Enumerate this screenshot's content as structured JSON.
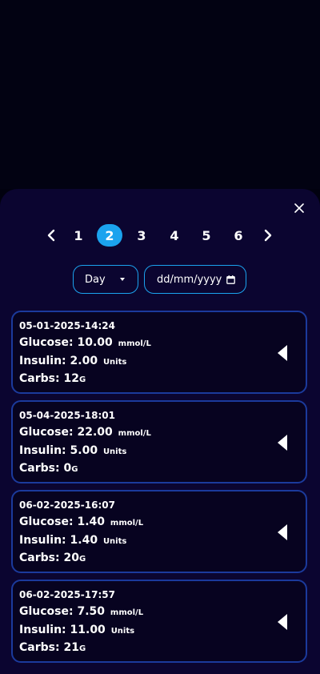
{
  "pagination": {
    "pages": [
      "1",
      "2",
      "3",
      "4",
      "5",
      "6"
    ],
    "active_index": 1
  },
  "filters": {
    "period_selected": "Day",
    "date_placeholder": "dd/mm/yyyy"
  },
  "labels": {
    "glucose": "Glucose:",
    "insulin": "Insulin:",
    "carbs": "Carbs:",
    "glucose_unit": "mmol/L",
    "insulin_unit": "Units",
    "carbs_unit": "G"
  },
  "entries": [
    {
      "timestamp": "05-01-2025-14:24",
      "glucose": "10.00",
      "insulin": "2.00",
      "carbs": "12"
    },
    {
      "timestamp": "05-04-2025-18:01",
      "glucose": "22.00",
      "insulin": "5.00",
      "carbs": "0"
    },
    {
      "timestamp": "06-02-2025-16:07",
      "glucose": "1.40",
      "insulin": "1.40",
      "carbs": "20"
    },
    {
      "timestamp": "06-02-2025-17:57",
      "glucose": "7.50",
      "insulin": "11.00",
      "carbs": "21"
    }
  ],
  "colors": {
    "accent": "#1ba3ee",
    "card_border": "#1b3a9c",
    "sheet_bg": "#0b0530"
  },
  "icons": {
    "close": "close-icon",
    "prev": "chevron-left-icon",
    "next": "chevron-right-icon",
    "calendar": "calendar-icon",
    "expand": "caret-left-icon"
  }
}
